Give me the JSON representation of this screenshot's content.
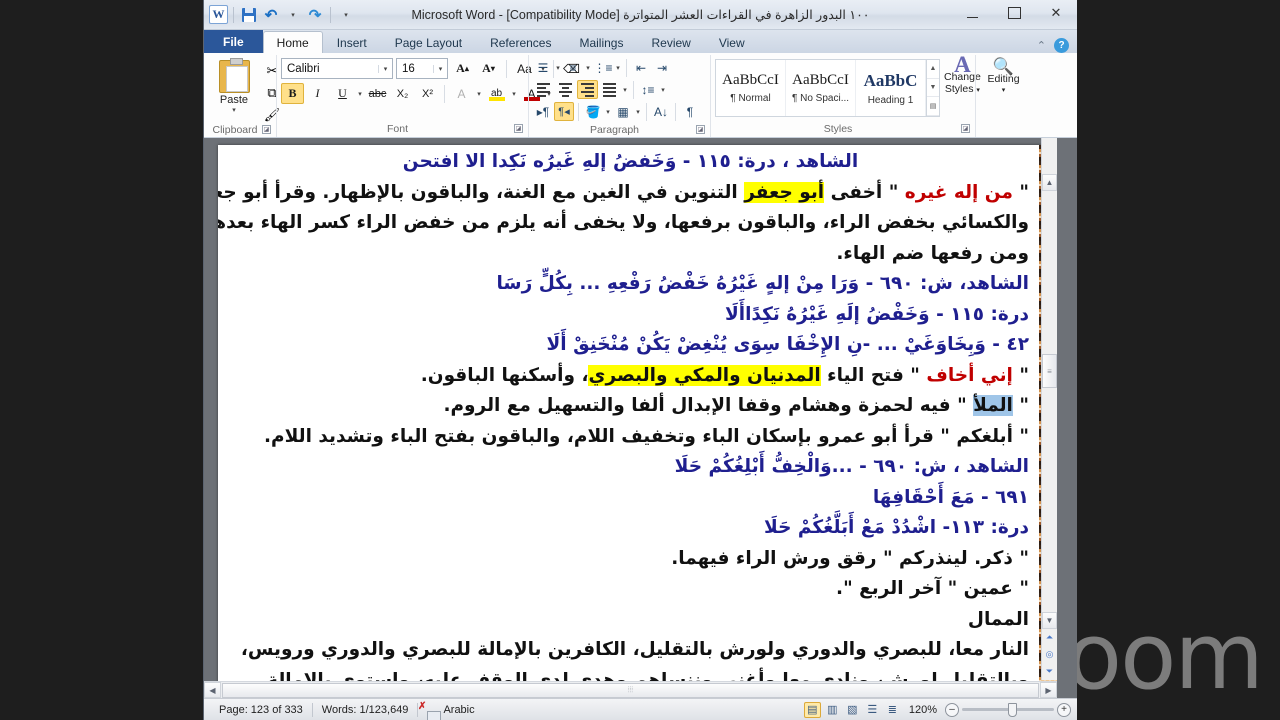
{
  "titlebar": {
    "app_logo": "word-logo",
    "document_title": "١٠٠ البدور الزاهرة في القراءات العشر المتواترة [Compatibility Mode]  -  Microsoft Word",
    "quick_access": [
      "save-icon",
      "undo-icon",
      "redo-icon",
      "customize-qat-icon"
    ],
    "minimize": "–",
    "maximize": "□",
    "close": "✕"
  },
  "ribbon": {
    "tabs": [
      {
        "label": "File",
        "active": false,
        "file": true
      },
      {
        "label": "Home",
        "active": true
      },
      {
        "label": "Insert",
        "active": false
      },
      {
        "label": "Page Layout",
        "active": false
      },
      {
        "label": "References",
        "active": false
      },
      {
        "label": "Mailings",
        "active": false
      },
      {
        "label": "Review",
        "active": false
      },
      {
        "label": "View",
        "active": false
      }
    ],
    "help_label": "?",
    "groups": {
      "clipboard": {
        "label": "Clipboard",
        "paste_label": "Paste",
        "cut_icon": "scissors-icon",
        "copy_icon": "copy-icon",
        "format_painter_icon": "format-painter-icon"
      },
      "font": {
        "label": "Font",
        "font_name": "Calibri",
        "font_size": "16",
        "grow_font": "A",
        "shrink_font": "A",
        "change_case": "Aa",
        "clear_formatting": "clear-formatting-icon",
        "bold": "B",
        "italic": "I",
        "underline": "U",
        "strikethrough": "abc",
        "subscript": "X₂",
        "superscript": "X²",
        "text_effects": "A",
        "highlight": "ab",
        "font_color": "A"
      },
      "paragraph": {
        "label": "Paragraph",
        "bullets": "bullets-icon",
        "numbering": "numbering-icon",
        "multilevel": "multilevel-list-icon",
        "decrease_indent": "decrease-indent-icon",
        "increase_indent": "increase-indent-icon",
        "align_left": "align-left-icon",
        "align_center": "align-center-icon",
        "align_right": "align-right-icon",
        "justify": "justify-icon",
        "line_spacing": "line-spacing-icon",
        "ltr": "ltr-icon",
        "rtl": "rtl-icon",
        "shading": "shading-icon",
        "borders": "borders-icon",
        "sort": "sort-icon",
        "show_marks": "¶"
      },
      "styles": {
        "label": "Styles",
        "items": [
          {
            "preview": "AaBbCcI",
            "name": "¶ Normal"
          },
          {
            "preview": "AaBbCcI",
            "name": "¶ No Spaci..."
          },
          {
            "preview": "AaBbC",
            "name": "Heading 1"
          }
        ],
        "change_styles": "Change Styles",
        "change_styles_line1": "Change",
        "change_styles_line2": "Styles"
      },
      "editing": {
        "label": "Editing",
        "button_line1": "Editing",
        "icon": "binoculars-icon"
      }
    }
  },
  "document": {
    "lines": [
      {
        "id": "l1",
        "color": "blue",
        "align": "center",
        "text": "الشاهد ، درة: ١١٥ - وَخَفضُ إلهِ غَيرُه نَكِدا الا افتحن"
      },
      {
        "id": "l2",
        "color": "black",
        "align": "right",
        "html": "\" <span class=\"red\">من إله غيره</span> \" أخفى <span class=\"hl-yellow\">أبو جعفر</span> التنوين في الغين مع الغنة، والباقون بالإظهار. وقرأ أبو جعفر"
      },
      {
        "id": "l3",
        "color": "black",
        "align": "right",
        "text": "والكسائي بخفض الراء، والباقون برفعها، ولا يخفى أنه يلزم من خفض الراء كسر الهاء بعدها"
      },
      {
        "id": "l4",
        "color": "black",
        "align": "right",
        "text": "ومن رفعها ضم الهاء."
      },
      {
        "id": "l5",
        "color": "blue",
        "align": "right",
        "text": "الشاهد، ش: ٦٩٠ - وَرَا مِنْ إلهٍ غَيْرُهُ خَفْضُ رَفْعِهِ ... بِكُلٍّ رَسَا"
      },
      {
        "id": "l6",
        "color": "blue",
        "align": "right",
        "text": "درة: ١١٥ - وَخَفْضُ إلَهِ غَيْرُهُ نَكِدًاأَلَا"
      },
      {
        "id": "l7",
        "color": "blue",
        "align": "right",
        "text": "٤٢ - وَبِخَاوَغَيْ ... -نِ الإِخْفَا سِوَى يُنْغِضْ يَكُنْ مُنْخَنِقْ أَلَا"
      },
      {
        "id": "l8",
        "color": "black",
        "align": "right",
        "html": "\" <span class=\"red\">إني أخاف</span> \" فتح الياء <span class=\"hl-yellow\">المدنيان والمكي والبصري</span>، وأسكنها الباقون."
      },
      {
        "id": "l9",
        "color": "black",
        "align": "right",
        "html": "\" <span class=\"hl-blue\">الملأ</span> \" فيه لحمزة وهشام وقفا الإبدال ألفا والتسهيل مع الروم."
      },
      {
        "id": "l10",
        "color": "black",
        "align": "right",
        "text": "\" أبلغكم \" قرأ أبو عمرو بإسكان الباء وتخفيف اللام، والباقون بفتح الباء وتشديد اللام."
      },
      {
        "id": "l11",
        "color": "blue",
        "align": "right",
        "text": "الشاهد ، ش: ٦٩٠ - ...وَالْخِفُّ أَبْلِغُكُمْ حَلَا"
      },
      {
        "id": "l12",
        "color": "blue",
        "align": "right",
        "text": "٦٩١ - مَعَ أَحْقَافِهَا"
      },
      {
        "id": "l13",
        "color": "blue",
        "align": "right",
        "text": "درة: ١١٣- اشْدُدْ مَعْ أَبَلَّغُكُمْ حَلَا"
      },
      {
        "id": "l14",
        "color": "black",
        "align": "right",
        "text": "\" ذكر. لينذركم \" رقق ورش الراء فيهما."
      },
      {
        "id": "l15",
        "color": "black",
        "align": "right",
        "text": "\" عمين \" آخر الربع \"."
      },
      {
        "id": "l16",
        "color": "black",
        "align": "right",
        "text": "الممال"
      },
      {
        "id": "l17",
        "color": "black",
        "align": "right",
        "text": ""
      },
      {
        "id": "l18",
        "color": "black",
        "align": "right",
        "text": "النار معا، للبصري والدوري ولورش بالتقليل، الكافرين بالإمالة للبصري والدوري ورويس،"
      },
      {
        "id": "l19",
        "color": "black",
        "align": "right",
        "text": "وبالتقليل لورش، ونادى معا وأغنى وننساهم وهدى لدى الوقف عليه، واستوى بالإمالة"
      }
    ],
    "scroll": {
      "up_arrow": "▲",
      "down_arrow": "▼",
      "previous_page": "▲",
      "select_browse_object": "◉",
      "next_page": "▼",
      "left_arrow": "◀",
      "right_arrow": "▶"
    }
  },
  "statusbar": {
    "page": "Page: 123 of 333",
    "words": "Words: 1/123,649",
    "proofing_icon": "proofing-errors-icon",
    "language": "Arabic",
    "views": [
      "print-layout-icon",
      "full-screen-reading-icon",
      "web-layout-icon",
      "outline-icon",
      "draft-icon"
    ],
    "zoom_level": "120%",
    "zoom_out": "–",
    "zoom_in": "+"
  },
  "watermark": {
    "text": "zoom"
  }
}
